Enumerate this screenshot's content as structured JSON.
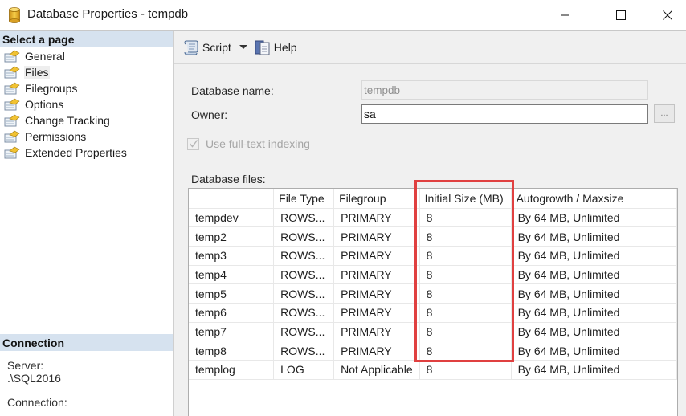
{
  "window": {
    "title": "Database Properties - tempdb",
    "app_icon": "database-cylinder-icon",
    "controls": [
      "minimize",
      "maximize",
      "close"
    ]
  },
  "sidebar": {
    "select_page_header": "Select a page",
    "pages": [
      {
        "label": "General",
        "icon": "property-page-icon"
      },
      {
        "label": "Files",
        "icon": "property-page-icon",
        "selected": true
      },
      {
        "label": "Filegroups",
        "icon": "property-page-icon"
      },
      {
        "label": "Options",
        "icon": "property-page-icon"
      },
      {
        "label": "Change Tracking",
        "icon": "property-page-icon"
      },
      {
        "label": "Permissions",
        "icon": "property-page-icon"
      },
      {
        "label": "Extended Properties",
        "icon": "property-page-icon"
      }
    ],
    "connection_header": "Connection",
    "server_label": "Server:",
    "server_value": ".\\SQL2016",
    "connection_label": "Connection:"
  },
  "toolbar": {
    "script_label": "Script",
    "help_label": "Help"
  },
  "form": {
    "database_name_label": "Database name:",
    "database_name_value": "tempdb",
    "owner_label": "Owner:",
    "owner_value": "sa",
    "browse_label": "...",
    "fulltext_label": "Use full-text indexing",
    "fulltext_checked": true,
    "fulltext_enabled": false,
    "database_files_label": "Database files:"
  },
  "grid": {
    "columns": [
      "",
      "File Type",
      "Filegroup",
      "Initial Size (MB)",
      "Autogrowth / Maxsize"
    ],
    "rows": [
      [
        "tempdev",
        "ROWS...",
        "PRIMARY",
        "8",
        "By 64 MB, Unlimited"
      ],
      [
        "temp2",
        "ROWS...",
        "PRIMARY",
        "8",
        "By 64 MB, Unlimited"
      ],
      [
        "temp3",
        "ROWS...",
        "PRIMARY",
        "8",
        "By 64 MB, Unlimited"
      ],
      [
        "temp4",
        "ROWS...",
        "PRIMARY",
        "8",
        "By 64 MB, Unlimited"
      ],
      [
        "temp5",
        "ROWS...",
        "PRIMARY",
        "8",
        "By 64 MB, Unlimited"
      ],
      [
        "temp6",
        "ROWS...",
        "PRIMARY",
        "8",
        "By 64 MB, Unlimited"
      ],
      [
        "temp7",
        "ROWS...",
        "PRIMARY",
        "8",
        "By 64 MB, Unlimited"
      ],
      [
        "temp8",
        "ROWS...",
        "PRIMARY",
        "8",
        "By 64 MB, Unlimited"
      ],
      [
        "templog",
        "LOG",
        "Not Applicable",
        "8",
        "By 64 MB, Unlimited"
      ]
    ],
    "highlight_color": "#e04040"
  }
}
